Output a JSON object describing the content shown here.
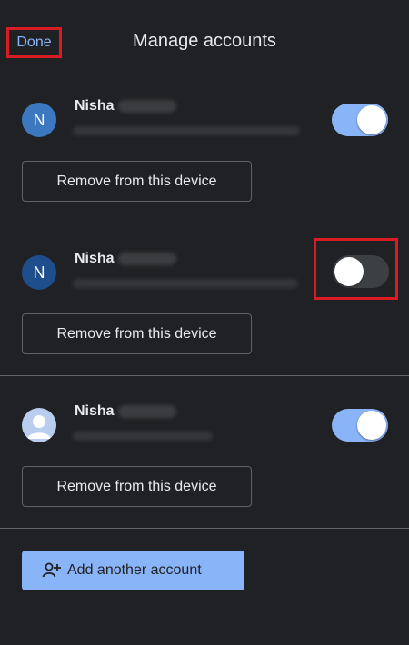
{
  "header": {
    "done_label": "Done",
    "title": "Manage accounts"
  },
  "accounts": [
    {
      "initial": "N",
      "name": "Nisha",
      "remove_label": "Remove from this device",
      "toggle_on": true
    },
    {
      "initial": "N",
      "name": "Nisha",
      "remove_label": "Remove from this device",
      "toggle_on": false
    },
    {
      "initial": "",
      "name": "Nisha",
      "remove_label": "Remove from this device",
      "toggle_on": true
    }
  ],
  "add_account_label": "Add another account",
  "colors": {
    "background": "#202124",
    "accent": "#8ab4f8",
    "highlight": "#d91c24"
  },
  "icons": [
    "person-avatar-icon",
    "add-person-icon"
  ]
}
